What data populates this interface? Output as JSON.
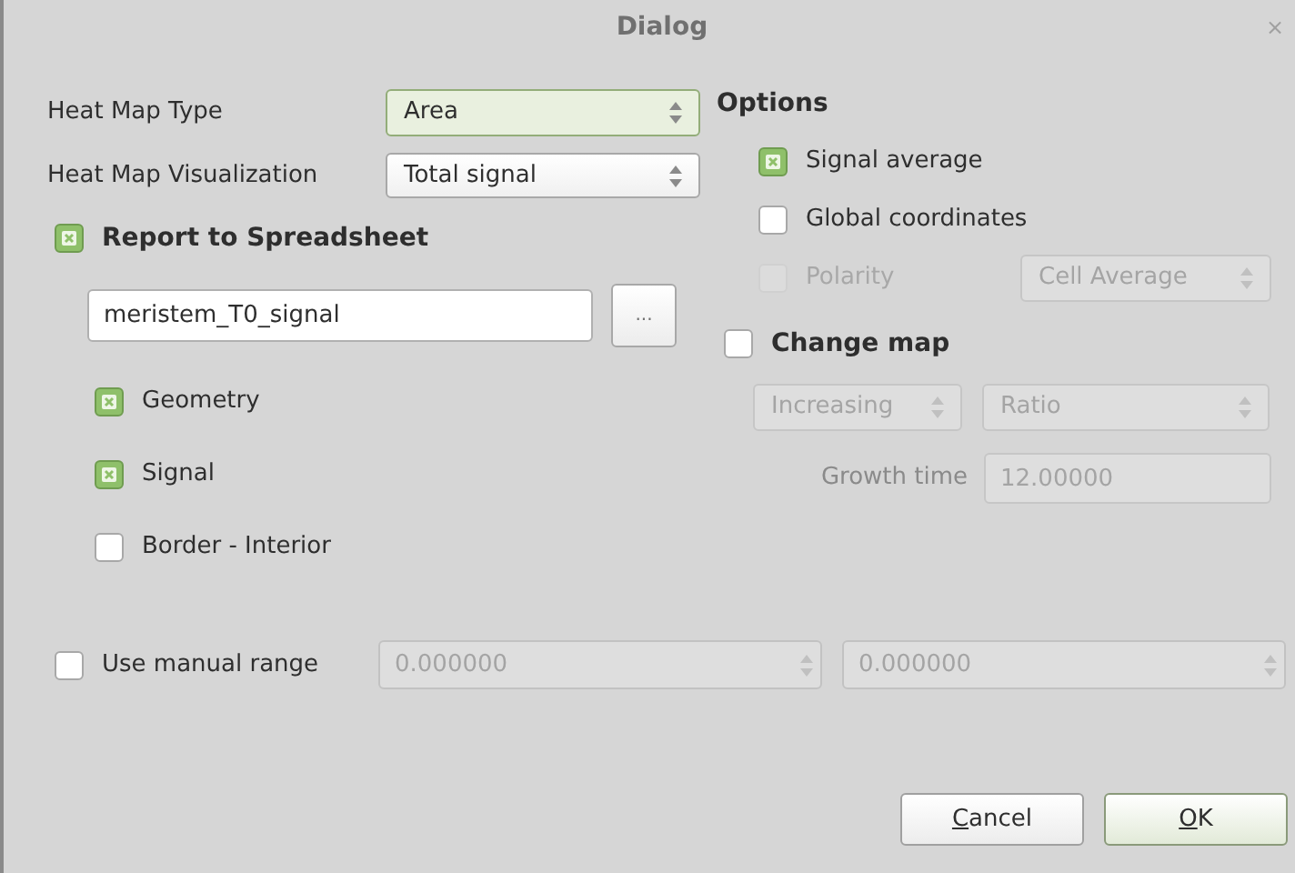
{
  "window": {
    "title": "Dialog",
    "close": "×"
  },
  "heat_map_type": {
    "label": "Heat Map Type",
    "value": "Area",
    "focused": true
  },
  "heat_map_visualization": {
    "label": "Heat Map Visualization",
    "value": "Total signal",
    "focused": false
  },
  "report": {
    "label": "Report to Spreadsheet",
    "checked": true,
    "filename": "meristem_T0_signal",
    "browse": "...",
    "options": [
      {
        "label": "Geometry",
        "checked": true
      },
      {
        "label": "Signal",
        "checked": true
      },
      {
        "label": "Border - Interior",
        "checked": false
      }
    ]
  },
  "options": {
    "title": "Options",
    "items": [
      {
        "label": "Signal average",
        "checked": true,
        "disabled": false
      },
      {
        "label": "Global coordinates",
        "checked": false,
        "disabled": false
      },
      {
        "label": "Polarity",
        "checked": false,
        "disabled": true,
        "combo": "Cell Average"
      }
    ]
  },
  "change_map": {
    "label": "Change map",
    "checked": false,
    "direction": "Increasing",
    "mode": "Ratio",
    "growth_time_label": "Growth time",
    "growth_time": "12.00000"
  },
  "manual_range": {
    "label": "Use manual range",
    "checked": false,
    "min": "0.000000",
    "max": "0.000000"
  },
  "buttons": [
    {
      "label": "Cancel",
      "default": false
    },
    {
      "label": "OK",
      "default": true
    }
  ]
}
